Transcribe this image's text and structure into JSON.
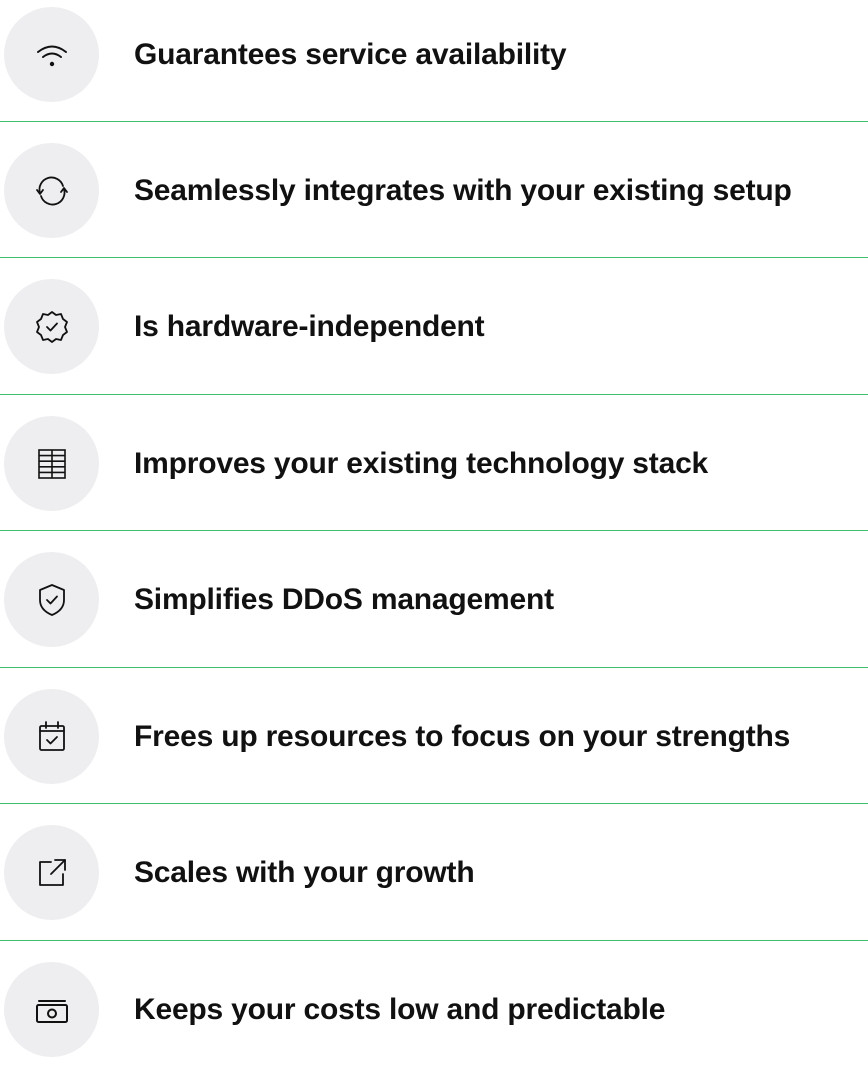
{
  "features": [
    {
      "icon": "wifi-icon",
      "label": "Guarantees service availability"
    },
    {
      "icon": "sync-icon",
      "label": "Seamlessly integrates with your existing setup"
    },
    {
      "icon": "badge-check-icon",
      "label": "Is hardware-independent"
    },
    {
      "icon": "server-stack-icon",
      "label": "Improves your existing technology stack"
    },
    {
      "icon": "shield-check-icon",
      "label": "Simplifies DDoS management"
    },
    {
      "icon": "calendar-check-icon",
      "label": "Frees up resources to focus on your strengths"
    },
    {
      "icon": "external-link-icon",
      "label": "Scales with your growth"
    },
    {
      "icon": "banknote-icon",
      "label": "Keeps your costs low and predictable"
    }
  ],
  "colors": {
    "divider": "#3fbf6a",
    "icon_bg": "#eeeef0",
    "text": "#111111"
  }
}
